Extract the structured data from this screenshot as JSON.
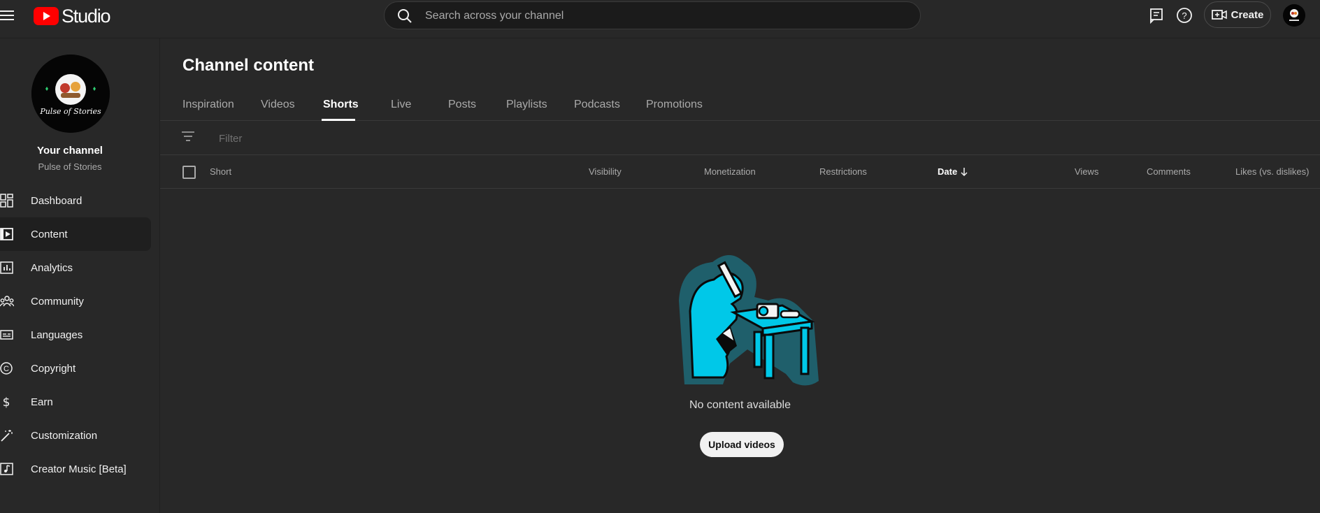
{
  "app": {
    "logo_text": "Studio",
    "search_placeholder": "Search across your channel",
    "create_label": "Create"
  },
  "sidebar": {
    "your_channel_label": "Your channel",
    "channel_name": "Pulse of Stories",
    "avatar_text": "Pulse of Stories",
    "items": [
      {
        "label": "Dashboard",
        "icon": "dashboard-icon"
      },
      {
        "label": "Content",
        "icon": "content-icon",
        "active": true
      },
      {
        "label": "Analytics",
        "icon": "analytics-icon"
      },
      {
        "label": "Community",
        "icon": "community-icon"
      },
      {
        "label": "Languages",
        "icon": "languages-icon"
      },
      {
        "label": "Copyright",
        "icon": "copyright-icon"
      },
      {
        "label": "Earn",
        "icon": "earn-icon"
      },
      {
        "label": "Customization",
        "icon": "customization-icon"
      },
      {
        "label": "Creator Music [Beta]",
        "icon": "creator-music-icon"
      }
    ]
  },
  "main": {
    "title": "Channel content",
    "tabs": [
      {
        "label": "Inspiration"
      },
      {
        "label": "Videos"
      },
      {
        "label": "Shorts",
        "active": true
      },
      {
        "label": "Live"
      },
      {
        "label": "Posts"
      },
      {
        "label": "Playlists"
      },
      {
        "label": "Podcasts"
      },
      {
        "label": "Promotions"
      }
    ],
    "filter_placeholder": "Filter",
    "columns": {
      "short": "Short",
      "visibility": "Visibility",
      "monetization": "Monetization",
      "restrictions": "Restrictions",
      "date": "Date",
      "views": "Views",
      "comments": "Comments",
      "likes": "Likes (vs. dislikes)"
    },
    "empty_text": "No content available",
    "upload_label": "Upload videos"
  },
  "colors": {
    "background": "#282828",
    "brand_red": "#ff0000",
    "illustration_cyan": "#00c8e8",
    "illustration_teal": "#1f5f6b"
  }
}
